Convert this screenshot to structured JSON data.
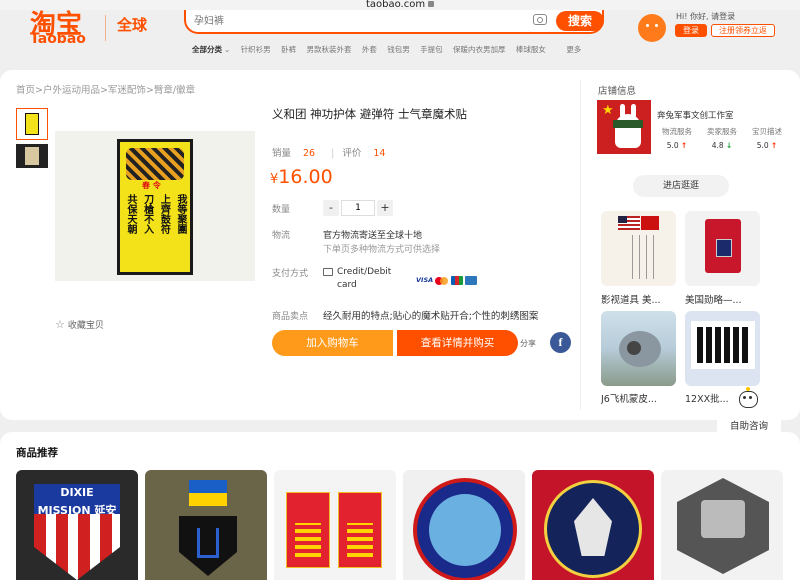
{
  "browser": {
    "url": "taobao.com"
  },
  "header": {
    "logo_cn": "淘宝",
    "logo_en": "Taobao",
    "logo_global": "全球",
    "search_placeholder": "孕妇裤",
    "search_button": "搜索",
    "categories": [
      "全部分类",
      "针织衫男",
      "卧裤",
      "男款秋装外套",
      "外套",
      "钱包男",
      "手提包",
      "保暖内衣男加厚",
      "棒球服女",
      "更多"
    ],
    "user_text": "Hi! 你好, 请登录",
    "login": "登录",
    "register": "注册领券立返"
  },
  "breadcrumb": "首页>户外运动用品>军迷配饰>臂章/徽章",
  "product": {
    "title": "义和团 神功护体 避弹符 士气章魔术贴",
    "sales_label": "销量",
    "sales": "26",
    "reviews_label": "评价",
    "reviews": "14",
    "currency": "¥",
    "price": "16.00",
    "quantity_label": "数量",
    "quantity": "1",
    "shipping_label": "物流",
    "shipping_text": "官方物流寄送至全球十地",
    "shipping_note": "下单页多种物流方式可供选择",
    "payment_label": "支付方式",
    "payment_method": "Credit/Debit card",
    "payment_logos": {
      "visa": "VISA"
    },
    "highlights_label": "商品卖点",
    "highlights": "经久耐用的特点;贴心的魔术贴开合;个性的刺绣图案",
    "favorite": "收藏宝贝",
    "add_to_cart": "加入购物车",
    "view_details": "查看详情并购买",
    "share": "分享",
    "facebook_icon": "f",
    "patch_red_text": "春 令",
    "patch_columns": [
      "我等聚團",
      "上齊鼓符",
      "刀槍不入",
      "共保天朝"
    ]
  },
  "shop": {
    "section_label": "店铺信息",
    "name": "奔兔军事文创工作室",
    "logo_star": "★",
    "stats": [
      {
        "label": "物流服务",
        "value": "5.0",
        "trend": "↑",
        "trend_type": "up"
      },
      {
        "label": "卖家服务",
        "value": "4.8",
        "trend": "↓",
        "trend_type": "down"
      },
      {
        "label": "宝贝描述",
        "value": "5.0",
        "trend": "↑",
        "trend_type": "up"
      }
    ],
    "visit_button": "进店逛逛",
    "recommended": [
      {
        "label": "影视道具 美..."
      },
      {
        "label": "美国勋略—..."
      },
      {
        "label": "J6飞机蒙皮..."
      },
      {
        "label": "12XX批..."
      }
    ]
  },
  "support": {
    "help_button": "自助咨询"
  },
  "recommend": {
    "title": "商品推荐",
    "dixie_text": "DIXIE MISSION 延安"
  },
  "colors": {
    "accent": "#ff5000",
    "cart_button": "#ff9a1a"
  }
}
